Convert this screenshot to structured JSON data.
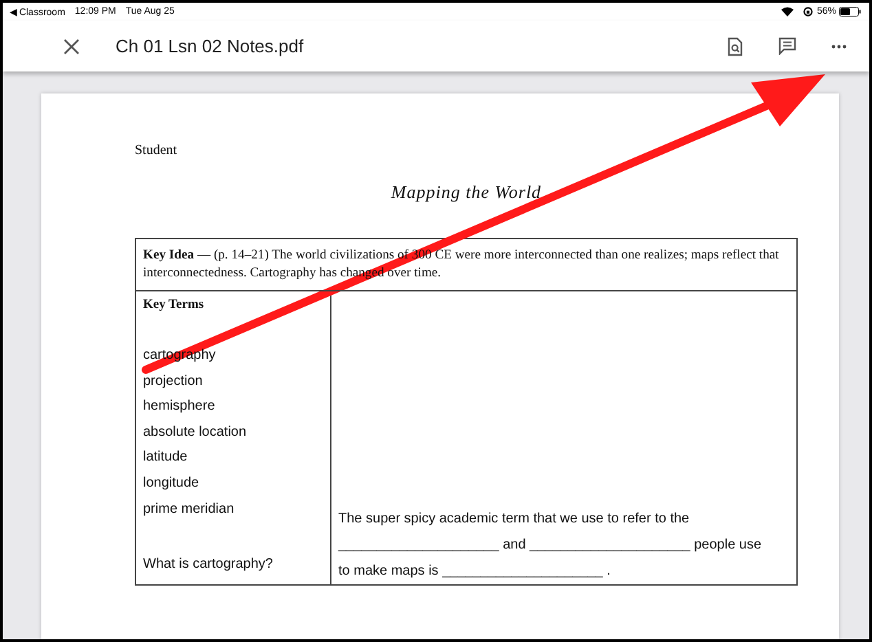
{
  "status_bar": {
    "back_app": "◀ Classroom",
    "time": "12:09 PM",
    "date": "Tue Aug 25",
    "battery_percent": "56%"
  },
  "header": {
    "title": "Ch 01 Lsn 02 Notes.pdf"
  },
  "document": {
    "student_label": "Student",
    "title": "Mapping the World",
    "key_idea": "**Key Idea** — (p. 14–21) The world civilizations of 300 CE were more interconnected than one realizes; maps reflect that interconnectedness. Cartography has changed over time.",
    "key_terms_heading": "Key Terms",
    "key_terms": [
      "cartography",
      "projection",
      "hemisphere",
      "absolute location",
      "latitude",
      "longitude",
      "prime meridian"
    ],
    "question": "What is cartography?",
    "answer_lines": [
      "The super spicy academic term that we use to refer to the",
      "_____________________ and _____________________ people use",
      "to make maps is _____________________ ."
    ]
  }
}
